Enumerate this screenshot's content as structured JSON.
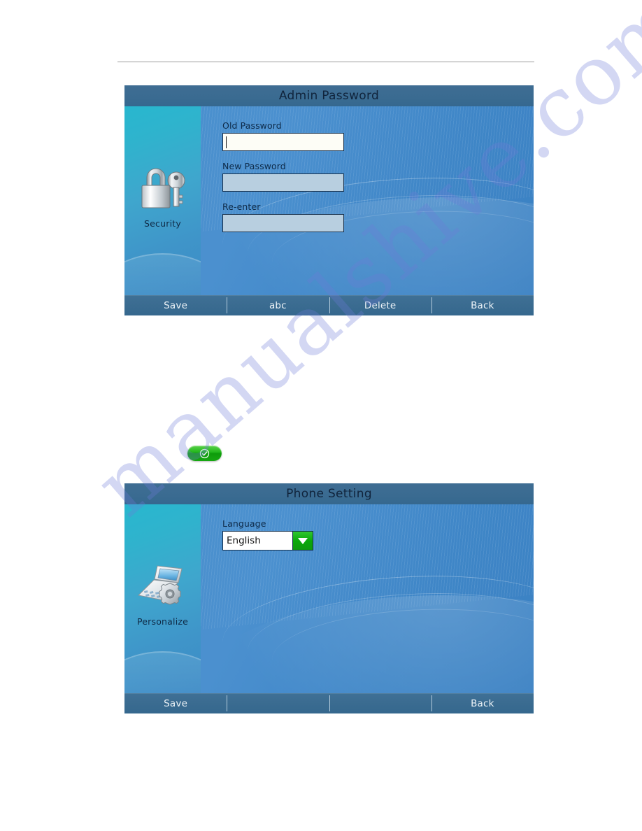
{
  "document": {
    "watermark_text": "manualshive.com",
    "watermark_color": "#6c7ad6"
  },
  "theme": {
    "titlebar_color": "#3d6e93",
    "body_blue": "#4a8fcd",
    "sidebar_cyan": "#2fb3cd",
    "field_fill": "#b8cfe0",
    "field_focus_fill": "#fdfdf6",
    "accent_green": "#0aa80a",
    "title_text_color": "#10243c",
    "toolbar_text_color": "#eef4f8"
  },
  "screens": [
    {
      "id": "admin-password",
      "title": "Admin Password",
      "sidebar": {
        "icon": "padlock-key-icon",
        "label": "Security"
      },
      "fields": [
        {
          "label": "Old Password",
          "value": "",
          "focused": true
        },
        {
          "label": "New Password",
          "value": "",
          "focused": false
        },
        {
          "label": "Re-enter",
          "value": "",
          "focused": false
        }
      ],
      "toolbar": [
        {
          "label": "Save"
        },
        {
          "label": "abc"
        },
        {
          "label": "Delete"
        },
        {
          "label": "Back"
        }
      ]
    },
    {
      "id": "phone-setting",
      "title": "Phone Setting",
      "sidebar": {
        "icon": "phone-gear-icon",
        "label": "Personalize"
      },
      "dropdown": {
        "label": "Language",
        "value": "English",
        "arrow_icon": "chevron-down-icon"
      },
      "toolbar": [
        {
          "label": "Save"
        },
        {
          "label": ""
        },
        {
          "label": ""
        },
        {
          "label": "Back"
        }
      ]
    }
  ],
  "badge": {
    "icon": "check-circle-icon",
    "color": "#0aa80a"
  }
}
